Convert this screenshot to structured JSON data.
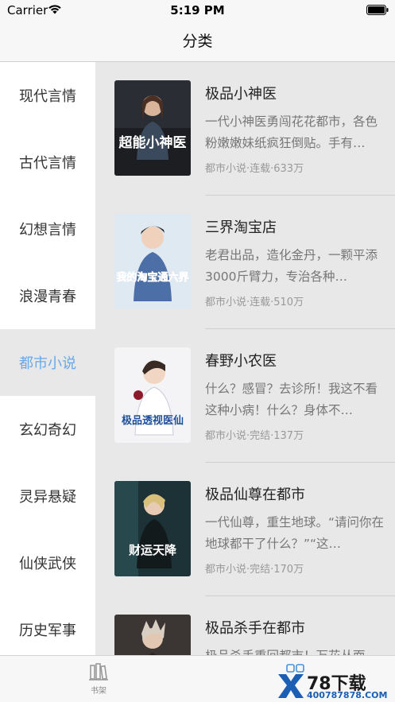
{
  "status_bar": {
    "carrier": "Carrier",
    "time": "5:19 PM"
  },
  "nav": {
    "title": "分类"
  },
  "sidebar": {
    "items": [
      {
        "label": "现代言情"
      },
      {
        "label": "古代言情"
      },
      {
        "label": "幻想言情"
      },
      {
        "label": "浪漫青春"
      },
      {
        "label": "都市小说"
      },
      {
        "label": "玄幻奇幻"
      },
      {
        "label": "灵异悬疑"
      },
      {
        "label": "仙侠武侠"
      },
      {
        "label": "历史军事"
      }
    ],
    "active_index": 4,
    "active_color": "#6aa8e8"
  },
  "books": [
    {
      "title": "极品小神医",
      "desc": "一代小神医勇闯花花都市，各色粉嫩嫩妹纸疯狂倒贴。手有…",
      "meta": "都市小说·连载·633万",
      "cover_text": "超能小神医"
    },
    {
      "title": "三界淘宝店",
      "desc": "老君出品，造化金丹，一颗平添3000斤臂力，专治各种…",
      "meta": "都市小说·连载·510万",
      "cover_text": "我的淘宝通六界"
    },
    {
      "title": "春野小农医",
      "desc": "什么？感冒？去诊所！我这不看这种小病！什么？身体不…",
      "meta": "都市小说·完结·137万",
      "cover_text": "极品透视医仙"
    },
    {
      "title": "极品仙尊在都市",
      "desc": "一代仙尊，重生地球。“请问你在地球都干了什么？”“这…",
      "meta": "都市小说·完结·170万",
      "cover_text": "财运天降"
    },
    {
      "title": "极品杀手在都市",
      "desc": "极品杀手重回都市！万花丛面…",
      "meta": "",
      "cover_text": ""
    }
  ],
  "tab_bar": {
    "shelf_label": "书架"
  },
  "watermark": {
    "brand": "78下载",
    "url": "400787878.COM"
  }
}
